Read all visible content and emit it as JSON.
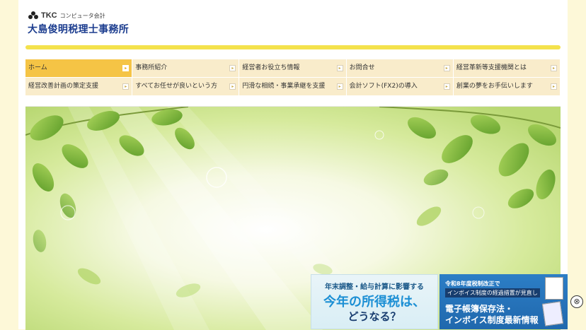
{
  "header": {
    "logo_brand": "TKC",
    "logo_sub": "コンピュータ会計",
    "site_title": "大島俊明税理士事務所"
  },
  "nav": {
    "row1": [
      {
        "label": "ホーム",
        "active": true
      },
      {
        "label": "事務所紹介",
        "active": false
      },
      {
        "label": "経営者お役立ち情報",
        "active": false
      },
      {
        "label": "お問合せ",
        "active": false
      },
      {
        "label": "経営革新等支援機関とは",
        "active": false
      }
    ],
    "row2": [
      {
        "label": "経営改善計画の策定支援",
        "active": false
      },
      {
        "label": "すべてお任せが良いという方",
        "active": false
      },
      {
        "label": "円滑な相続・事業承継を支援",
        "active": false
      },
      {
        "label": "会計ソフト(FX2)の導入",
        "active": false
      },
      {
        "label": "創業の夢をお手伝いします",
        "active": false
      }
    ],
    "arrow_glyph": "▸"
  },
  "banners": {
    "banner1": {
      "top": "年末調整・給与計算に影響する",
      "main": "今年の所得税は、",
      "sub": "どうなる？"
    },
    "banner2": {
      "line1": "令和8年度税制改正で",
      "line2": "インボイス制度の経過措置が見直し",
      "line3": "電子帳簿保存法・",
      "line4": "インボイス制度最新情報"
    },
    "close_glyph": "⊗"
  },
  "colors": {
    "accent": "#f5c445",
    "title_blue": "#1c3d8f",
    "bar_yellow": "#f4e24c",
    "nav_bg": "#f9eccb"
  }
}
